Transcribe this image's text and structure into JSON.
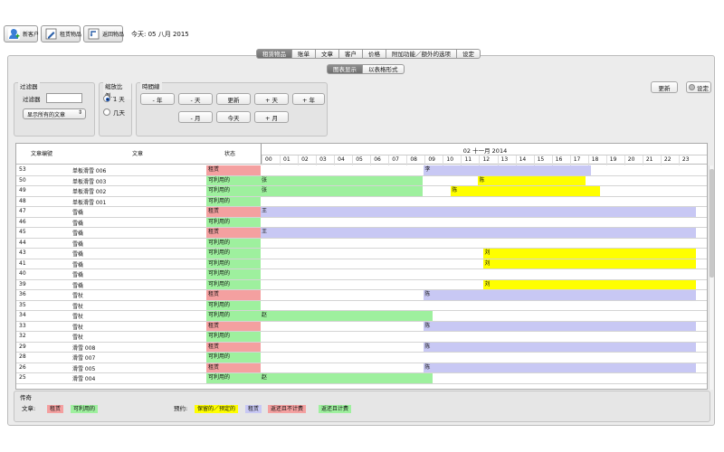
{
  "toolbar": {
    "new_customer": "新客户",
    "rent_item": "租赁物品",
    "return_item": "返回物品",
    "today": "今天: 05 八月 2015"
  },
  "main_tabs": [
    "租赁物品",
    "账单",
    "文章",
    "客户",
    "价格",
    "附加功能／额外的选项",
    "设定"
  ],
  "sub_tabs": [
    "图表显示",
    "以表格形式"
  ],
  "filter_group": {
    "title": "过滤器",
    "label": "过滤器",
    "input_value": "",
    "select_value": "显示所有的文章"
  },
  "zoom_group": {
    "title": "缩放比例...",
    "options": [
      "1 天",
      "几天"
    ],
    "selected": 0
  },
  "timeline_group": {
    "title": "時間線",
    "buttons": [
      "- 年",
      "- 天",
      "更新",
      "+ 天",
      "+ 年",
      "- 月",
      "今天",
      "+ 月"
    ]
  },
  "right_buttons": {
    "refresh": "更新",
    "settings": "设定"
  },
  "grid": {
    "headers": {
      "id": "文章编號",
      "article": "文章",
      "status": "状态"
    },
    "date": "02 十一月 2014",
    "hours": [
      "00",
      "01",
      "02",
      "03",
      "04",
      "05",
      "06",
      "07",
      "08",
      "09",
      "10",
      "11",
      "12",
      "13",
      "14",
      "15",
      "16",
      "17",
      "18",
      "19",
      "20",
      "21",
      "22",
      "23"
    ]
  },
  "colors": {
    "rented": "#f4a0a0",
    "available": "#9ef09e",
    "reserved": "#ffff00",
    "blue": "#c8c8f4"
  },
  "rows": [
    {
      "id": "53",
      "name": "单板滑雪 006",
      "status": "租赁",
      "type": "rented",
      "bars": [
        {
          "start": 9,
          "end": 18.2,
          "color": "blue",
          "label": "李"
        }
      ]
    },
    {
      "id": "50",
      "name": "单板滑雪 003",
      "status": "可利用的",
      "type": "available",
      "bars": [
        {
          "start": 0,
          "end": 8.95,
          "color": "available",
          "label": "张"
        },
        {
          "start": 12,
          "end": 17.9,
          "color": "reserved",
          "label": "陈"
        }
      ]
    },
    {
      "id": "49",
      "name": "单板滑雪 002",
      "status": "可利用的",
      "type": "available",
      "bars": [
        {
          "start": 0,
          "end": 8.95,
          "color": "available",
          "label": "张"
        },
        {
          "start": 10.5,
          "end": 18.7,
          "color": "reserved",
          "label": "陈"
        }
      ]
    },
    {
      "id": "48",
      "name": "单板滑雪 001",
      "status": "可利用的",
      "type": "available",
      "bars": []
    },
    {
      "id": "47",
      "name": "雪橇",
      "status": "租赁",
      "type": "rented",
      "bars": [
        {
          "start": 0,
          "end": 24,
          "color": "blue",
          "label": "王"
        }
      ]
    },
    {
      "id": "46",
      "name": "雪橇",
      "status": "可利用的",
      "type": "available",
      "bars": []
    },
    {
      "id": "45",
      "name": "雪橇",
      "status": "租赁",
      "type": "rented",
      "bars": [
        {
          "start": 0,
          "end": 24,
          "color": "blue",
          "label": "王"
        }
      ]
    },
    {
      "id": "44",
      "name": "雪橇",
      "status": "可利用的",
      "type": "available",
      "bars": []
    },
    {
      "id": "43",
      "name": "雪橇",
      "status": "可利用的",
      "type": "available",
      "bars": [
        {
          "start": 12.3,
          "end": 24,
          "color": "reserved",
          "label": "刘"
        }
      ]
    },
    {
      "id": "41",
      "name": "雪橇",
      "status": "可利用的",
      "type": "available",
      "bars": [
        {
          "start": 12.3,
          "end": 24,
          "color": "reserved",
          "label": "刘"
        }
      ]
    },
    {
      "id": "40",
      "name": "雪橇",
      "status": "可利用的",
      "type": "available",
      "bars": []
    },
    {
      "id": "39",
      "name": "雪橇",
      "status": "可利用的",
      "type": "available",
      "bars": [
        {
          "start": 12.3,
          "end": 24,
          "color": "reserved",
          "label": "刘"
        }
      ]
    },
    {
      "id": "36",
      "name": "雪杖",
      "status": "租赁",
      "type": "rented",
      "bars": [
        {
          "start": 9,
          "end": 24,
          "color": "blue",
          "label": "陈"
        }
      ]
    },
    {
      "id": "35",
      "name": "雪杖",
      "status": "可利用的",
      "type": "available",
      "bars": []
    },
    {
      "id": "34",
      "name": "雪杖",
      "status": "可利用的",
      "type": "available",
      "bars": [
        {
          "start": 0,
          "end": 9.5,
          "color": "available",
          "label": "赵"
        }
      ]
    },
    {
      "id": "33",
      "name": "雪杖",
      "status": "租赁",
      "type": "rented",
      "bars": [
        {
          "start": 9,
          "end": 24,
          "color": "blue",
          "label": "陈"
        }
      ]
    },
    {
      "id": "32",
      "name": "雪杖",
      "status": "可利用的",
      "type": "available",
      "bars": []
    },
    {
      "id": "29",
      "name": "滑雪 008",
      "status": "租赁",
      "type": "rented",
      "bars": [
        {
          "start": 9,
          "end": 24,
          "color": "blue",
          "label": "陈"
        }
      ]
    },
    {
      "id": "28",
      "name": "滑雪 007",
      "status": "可利用的",
      "type": "available",
      "bars": []
    },
    {
      "id": "26",
      "name": "滑雪 005",
      "status": "租赁",
      "type": "rented",
      "bars": [
        {
          "start": 9,
          "end": 24,
          "color": "blue",
          "label": "陈"
        }
      ]
    },
    {
      "id": "25",
      "name": "滑雪 004",
      "status": "可利用的",
      "type": "available",
      "bars": [
        {
          "start": 0,
          "end": 9.5,
          "color": "available",
          "label": "赵"
        }
      ]
    }
  ],
  "legend": {
    "title": "传奇",
    "article_label": "文章:",
    "article_items": [
      {
        "text": "租赁",
        "color": "rented"
      },
      {
        "text": "可利用的",
        "color": "available"
      }
    ],
    "booking_label": "预约:",
    "booking_items": [
      {
        "text": "保留的／预定的",
        "color": "reserved"
      },
      {
        "text": "租赁",
        "color": "blue"
      },
      {
        "text": "返还且不计费",
        "color": "rented"
      },
      {
        "text": "返还且计费",
        "color": "available"
      }
    ]
  }
}
